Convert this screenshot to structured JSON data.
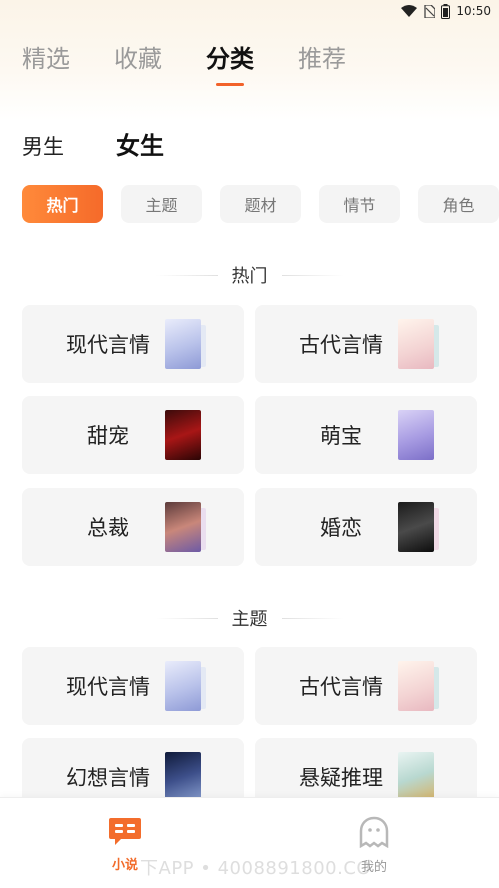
{
  "status_bar": {
    "time": "10:50",
    "icons": [
      "wifi-icon",
      "sim-icon",
      "battery-icon"
    ]
  },
  "top_tabs": [
    {
      "label": "精选",
      "active": false
    },
    {
      "label": "收藏",
      "active": false
    },
    {
      "label": "分类",
      "active": true
    },
    {
      "label": "推荐",
      "active": false
    }
  ],
  "gender_tabs": [
    {
      "label": "男生",
      "active": false
    },
    {
      "label": "女生",
      "active": true
    }
  ],
  "filter_chips": [
    {
      "label": "热门",
      "active": true
    },
    {
      "label": "主题",
      "active": false
    },
    {
      "label": "题材",
      "active": false
    },
    {
      "label": "情节",
      "active": false
    },
    {
      "label": "角色",
      "active": false
    }
  ],
  "sections": [
    {
      "title": "热门",
      "cards": [
        {
          "label": "现代言情",
          "cover": "cover-modern-romance"
        },
        {
          "label": "古代言情",
          "cover": "cover-ancient-romance"
        },
        {
          "label": "甜宠",
          "cover": "cover-sweet"
        },
        {
          "label": "萌宝",
          "cover": "cover-cute-baby"
        },
        {
          "label": "总裁",
          "cover": "cover-ceo"
        },
        {
          "label": "婚恋",
          "cover": "cover-marriage"
        }
      ]
    },
    {
      "title": "主题",
      "cards": [
        {
          "label": "现代言情",
          "cover": "cover-modern-romance"
        },
        {
          "label": "古代言情",
          "cover": "cover-ancient-romance"
        },
        {
          "label": "幻想言情",
          "cover": "cover-fantasy-romance"
        },
        {
          "label": "悬疑推理",
          "cover": "cover-mystery"
        }
      ]
    }
  ],
  "bottom_nav": [
    {
      "label": "小说",
      "icon": "novel-icon",
      "active": true
    },
    {
      "label": "我的",
      "icon": "profile-icon",
      "active": false
    }
  ],
  "watermark": "下APP • 4008891800.CO",
  "colors": {
    "accent": "#f56a2a",
    "chip_bg": "#f4f4f4",
    "card_bg": "#f5f5f5"
  }
}
